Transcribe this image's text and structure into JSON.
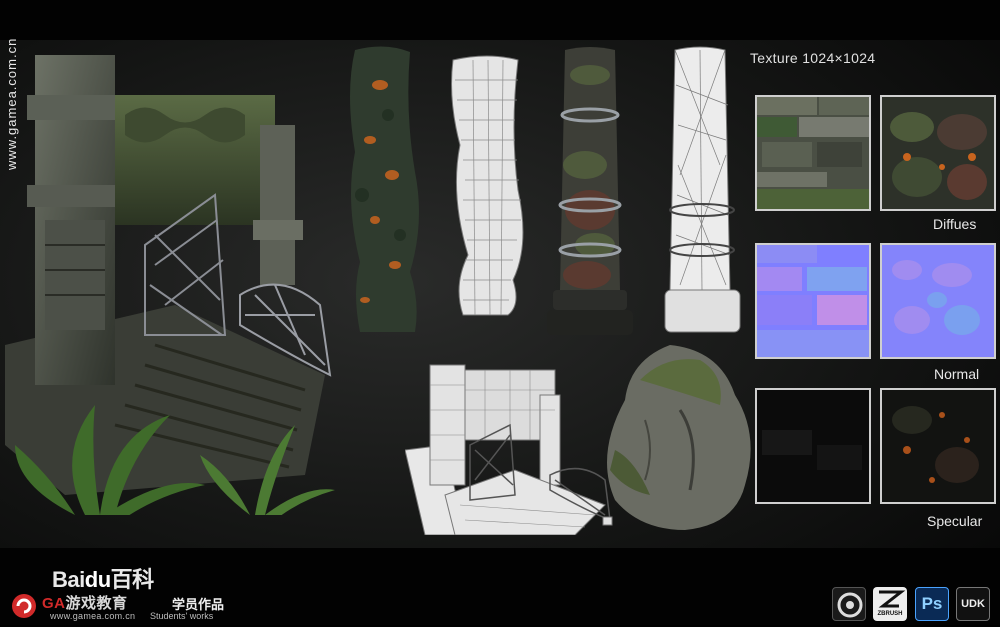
{
  "watermark": {
    "url_vertical": "www.gamea.com.cn"
  },
  "texture_panel": {
    "title": "Texture  1024×1024",
    "labels": {
      "diffuse": "Diffues",
      "normal": "Normal",
      "specular": "Specular"
    }
  },
  "footer": {
    "baidu_prefix": "Bai",
    "baidu_du": "du",
    "baidu_suffix": "百科",
    "ga_letters": "GA",
    "ga_cn": "游戏教育",
    "students_cn": "学员作品",
    "site_url": "www.gamea.com.cn",
    "students_en": "Students' works"
  },
  "software_icons": {
    "ps": "Ps",
    "zbrush": "ZBRUSH",
    "udk": "UDK"
  },
  "colors": {
    "background": "#141514",
    "normal_map": "#7f7fff",
    "lava": "#c8641e",
    "moss": "#4f6b3a",
    "accent_red": "#d12a2a"
  }
}
